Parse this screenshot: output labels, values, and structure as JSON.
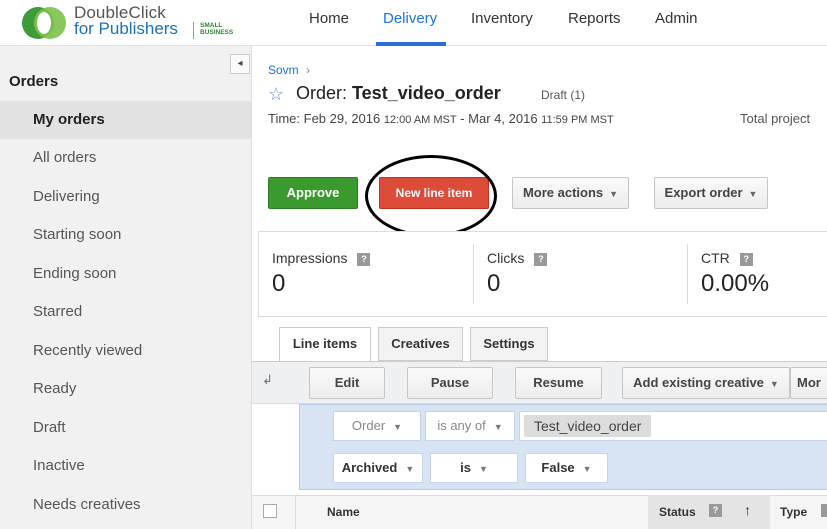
{
  "header": {
    "logo_line1": "DoubleClick",
    "logo_line2": "for Publishers",
    "logo_small1": "SMALL",
    "logo_small2": "BUSINESS",
    "nav": [
      {
        "label": "Home",
        "active": false
      },
      {
        "label": "Delivery",
        "active": true
      },
      {
        "label": "Inventory",
        "active": false
      },
      {
        "label": "Reports",
        "active": false
      },
      {
        "label": "Admin",
        "active": false
      }
    ]
  },
  "sidebar": {
    "title": "Orders",
    "collapse_icon": "◂",
    "items": [
      {
        "label": "My orders",
        "selected": true
      },
      {
        "label": "All orders"
      },
      {
        "label": "Delivering"
      },
      {
        "label": "Starting soon"
      },
      {
        "label": "Ending soon"
      },
      {
        "label": "Starred"
      },
      {
        "label": "Recently viewed"
      },
      {
        "label": "Ready"
      },
      {
        "label": "Draft"
      },
      {
        "label": "Inactive"
      },
      {
        "label": "Needs creatives"
      }
    ]
  },
  "order": {
    "breadcrumb": "Sovm",
    "breadcrumb_sep": "›",
    "star_icon": "☆",
    "title_prefix": "Order: ",
    "title_name": "Test_video_order",
    "status": "Draft (1)",
    "time_label": "Time:  Feb 29, 2016 ",
    "time_start_clock": "12:00 AM MST",
    "time_mid": " - Mar 4, 2016 ",
    "time_end_clock": "11:59 PM MST",
    "total_projected": "Total project"
  },
  "actions": {
    "approve": "Approve",
    "new_line_item": "New line item",
    "more_actions": "More actions",
    "export_order": "Export order",
    "caret": "▼"
  },
  "stats": [
    {
      "label": "Impressions",
      "value": "0"
    },
    {
      "label": "Clicks",
      "value": "0"
    },
    {
      "label": "CTR",
      "value": "0.00%"
    }
  ],
  "help_mark": "?",
  "tabs": [
    {
      "label": "Line items",
      "active": true
    },
    {
      "label": "Creatives"
    },
    {
      "label": "Settings"
    }
  ],
  "toolbar": {
    "back_icon": "↲",
    "edit": "Edit",
    "pause": "Pause",
    "resume": "Resume",
    "add_existing_creative": "Add existing creative",
    "more": "Mor"
  },
  "filters": {
    "field1": "Order",
    "op1": "is any of",
    "value1": "Test_video_order",
    "field2": "Archived",
    "op2": "is",
    "value2": "False"
  },
  "table": {
    "columns": [
      "Name",
      "Status",
      "Type"
    ],
    "sort_icon": "↑"
  },
  "colors": {
    "approve": "#3a9a2e",
    "new_line_item": "#dd4b39",
    "nav_active": "#1a73e8",
    "filter_bg": "#d8e3f4"
  }
}
